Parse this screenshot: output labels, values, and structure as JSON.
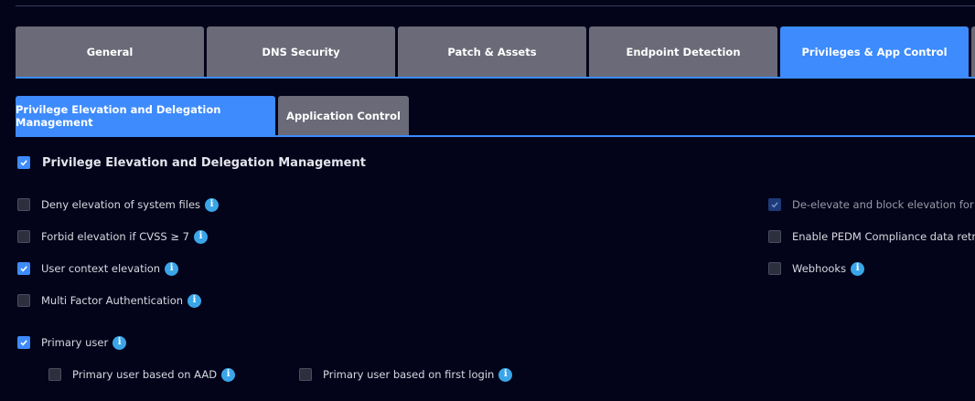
{
  "main_tabs": [
    {
      "label": "General",
      "active": false
    },
    {
      "label": "DNS Security",
      "active": false
    },
    {
      "label": "Patch & Assets",
      "active": false
    },
    {
      "label": "Endpoint Detection",
      "active": false
    },
    {
      "label": "Privileges & App Control",
      "active": true
    }
  ],
  "sub_tabs": [
    {
      "label": "Privilege Elevation and Delegation Management",
      "active": true
    },
    {
      "label": "Application Control",
      "active": false
    }
  ],
  "section": {
    "title": "Privilege Elevation and Delegation Management",
    "checked": true
  },
  "left_options": [
    {
      "label": "Deny elevation of system files",
      "checked": false,
      "info": true
    },
    {
      "label": "Forbid elevation if CVSS ≥ 7",
      "checked": false,
      "info": true
    },
    {
      "label": "User context elevation",
      "checked": true,
      "info": true
    },
    {
      "label": "Multi Factor Authentication",
      "checked": false,
      "info": true
    }
  ],
  "right_options": [
    {
      "label": "De-elevate and block elevation for us",
      "checked": true,
      "disabled": true,
      "info": false
    },
    {
      "label": "Enable PEDM Compliance data retrie",
      "checked": false,
      "info": false
    },
    {
      "label": "Webhooks",
      "checked": false,
      "info": true
    }
  ],
  "primary_user": {
    "label": "Primary user",
    "checked": true,
    "sub_options": [
      {
        "label": "Primary user based on AAD",
        "checked": false
      },
      {
        "label": "Primary user based on first login",
        "checked": false
      }
    ]
  },
  "info_icon_glyph": "i",
  "colors": {
    "accent": "#3d8bfd",
    "tab_inactive": "#6a6a78",
    "background": "#03031a",
    "info": "#3aa6e8"
  }
}
